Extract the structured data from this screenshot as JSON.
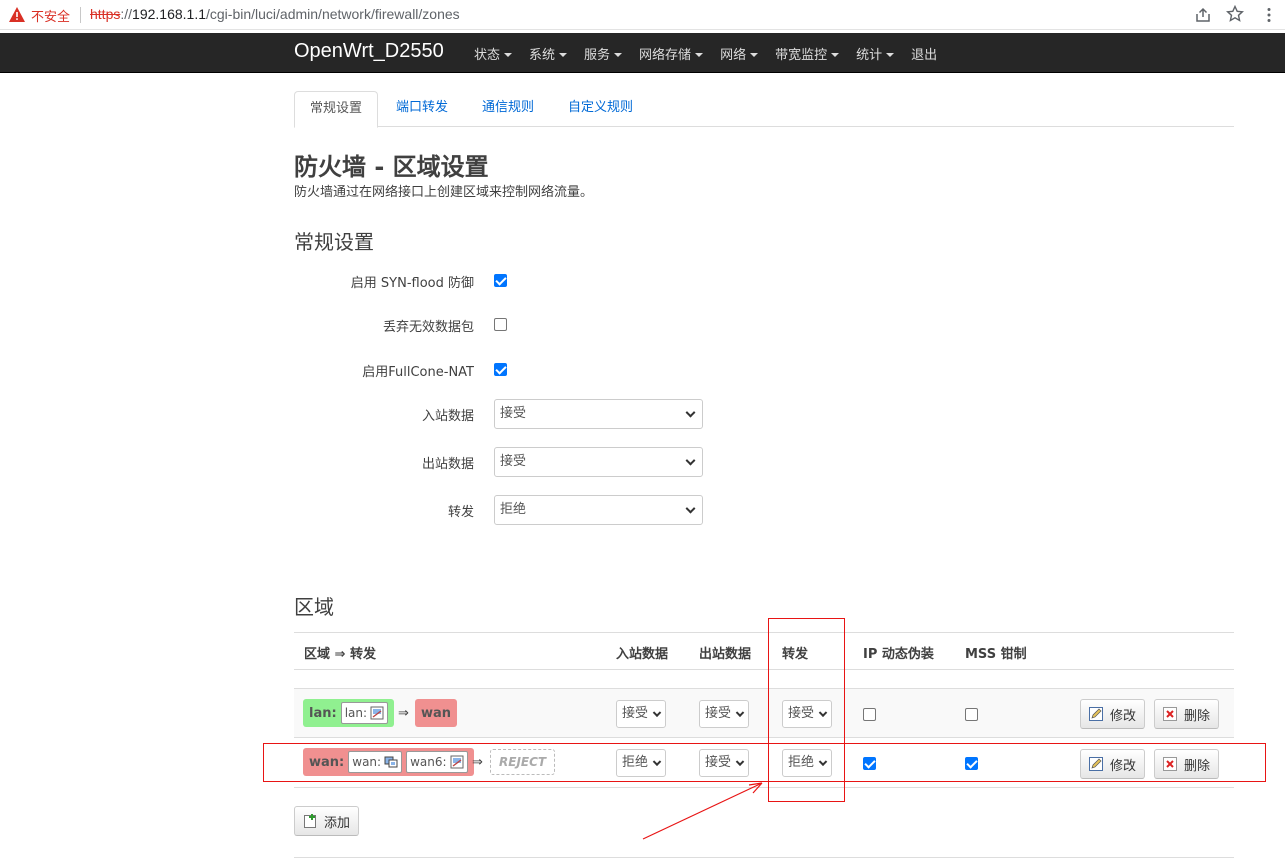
{
  "browser": {
    "insecure_label": "不安全",
    "url_scheme": "https",
    "url_sep": "://",
    "url_host": "192.168.1.1",
    "url_path": "/cgi-bin/luci/admin/network/firewall/zones"
  },
  "navbar": {
    "brand": "OpenWrt_D2550",
    "items": [
      "状态",
      "系统",
      "服务",
      "网络存储",
      "网络",
      "带宽监控",
      "统计",
      "退出"
    ]
  },
  "tabs": [
    "常规设置",
    "端口转发",
    "通信规则",
    "自定义规则"
  ],
  "page": {
    "title": "防火墙 - 区域设置",
    "description": "防火墙通过在网络接口上创建区域来控制网络流量。"
  },
  "general": {
    "section_title": "常规设置",
    "syn_flood": {
      "label": "启用 SYN-flood 防御",
      "checked": true
    },
    "drop_invalid": {
      "label": "丢弃无效数据包",
      "checked": false
    },
    "fullcone": {
      "label": "启用FullCone-NAT",
      "checked": true
    },
    "input": {
      "label": "入站数据",
      "value": "接受"
    },
    "output": {
      "label": "出站数据",
      "value": "接受"
    },
    "forward": {
      "label": "转发",
      "value": "拒绝"
    }
  },
  "zones": {
    "section_title": "区域",
    "headers": {
      "zone_forward": "区域 ⇒ 转发",
      "input": "入站数据",
      "output": "出站数据",
      "forward": "转发",
      "masq": "IP 动态伪装",
      "mss": "MSS 钳制"
    },
    "rows": [
      {
        "zone": "lan:",
        "ifaces": [
          "lan:"
        ],
        "arrow": "⇒",
        "dest": "wan",
        "input": "接受",
        "output": "接受",
        "forward": "接受",
        "masq": false,
        "mss": false
      },
      {
        "zone": "wan:",
        "ifaces": [
          "wan:",
          "wan6:"
        ],
        "arrow": "⇒",
        "dest": "REJECT",
        "input": "拒绝",
        "output": "接受",
        "forward": "拒绝",
        "masq": true,
        "mss": true
      }
    ],
    "edit_label": "修改",
    "delete_label": "删除",
    "add_label": "添加"
  },
  "colors": {
    "navbar_bg": "#262626",
    "lan_zone": "#90f090",
    "wan_zone": "#f09090",
    "link": "#0069d6",
    "annotation": "#e81414"
  }
}
